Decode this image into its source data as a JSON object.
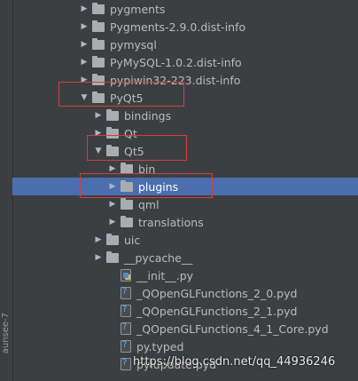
{
  "side_panel": {
    "label": "aunsee-7"
  },
  "tree": {
    "rows": [
      {
        "label": "pygments",
        "icon": "folder-icon",
        "arrow": "collapsed"
      },
      {
        "label": "Pygments-2.9.0.dist-info",
        "icon": "folder-icon",
        "arrow": "collapsed"
      },
      {
        "label": "pymysql",
        "icon": "folder-icon",
        "arrow": "collapsed"
      },
      {
        "label": "PyMySQL-1.0.2.dist-info",
        "icon": "folder-icon",
        "arrow": "collapsed"
      },
      {
        "label": "pypiwin32-223.dist-info",
        "icon": "folder-icon",
        "arrow": "collapsed"
      },
      {
        "label": "PyQt5",
        "icon": "folder-icon",
        "arrow": "expanded"
      },
      {
        "label": "bindings",
        "icon": "folder-icon",
        "arrow": "collapsed"
      },
      {
        "label": "Qt",
        "icon": "folder-icon",
        "arrow": "collapsed"
      },
      {
        "label": "Qt5",
        "icon": "folder-icon",
        "arrow": "expanded"
      },
      {
        "label": "bin",
        "icon": "folder-icon",
        "arrow": "collapsed"
      },
      {
        "label": "plugins",
        "icon": "folder-icon",
        "arrow": "collapsed",
        "selected": true
      },
      {
        "label": "qml",
        "icon": "folder-icon",
        "arrow": "collapsed"
      },
      {
        "label": "translations",
        "icon": "folder-icon",
        "arrow": "collapsed"
      },
      {
        "label": "uic",
        "icon": "folder-icon",
        "arrow": "collapsed"
      },
      {
        "label": "__pycache__",
        "icon": "folder-icon",
        "arrow": "collapsed"
      },
      {
        "label": "__init__.py",
        "icon": "python-file-icon",
        "arrow": "none"
      },
      {
        "label": "_QOpenGLFunctions_2_0.pyd",
        "icon": "unknown-file-icon",
        "arrow": "none"
      },
      {
        "label": "_QOpenGLFunctions_2_1.pyd",
        "icon": "unknown-file-icon",
        "arrow": "none"
      },
      {
        "label": "_QOpenGLFunctions_4_1_Core.pyd",
        "icon": "unknown-file-icon",
        "arrow": "none"
      },
      {
        "label": "py.typed",
        "icon": "unknown-file-icon",
        "arrow": "none"
      },
      {
        "label": "pylupdate.pyd",
        "icon": "unknown-file-icon",
        "arrow": "none"
      }
    ]
  },
  "watermark": "https://blog.csdn.net/qq_44936246",
  "colors": {
    "background": "#3c3f41",
    "selection": "#4b6eaf",
    "annotation": "#d24040"
  }
}
